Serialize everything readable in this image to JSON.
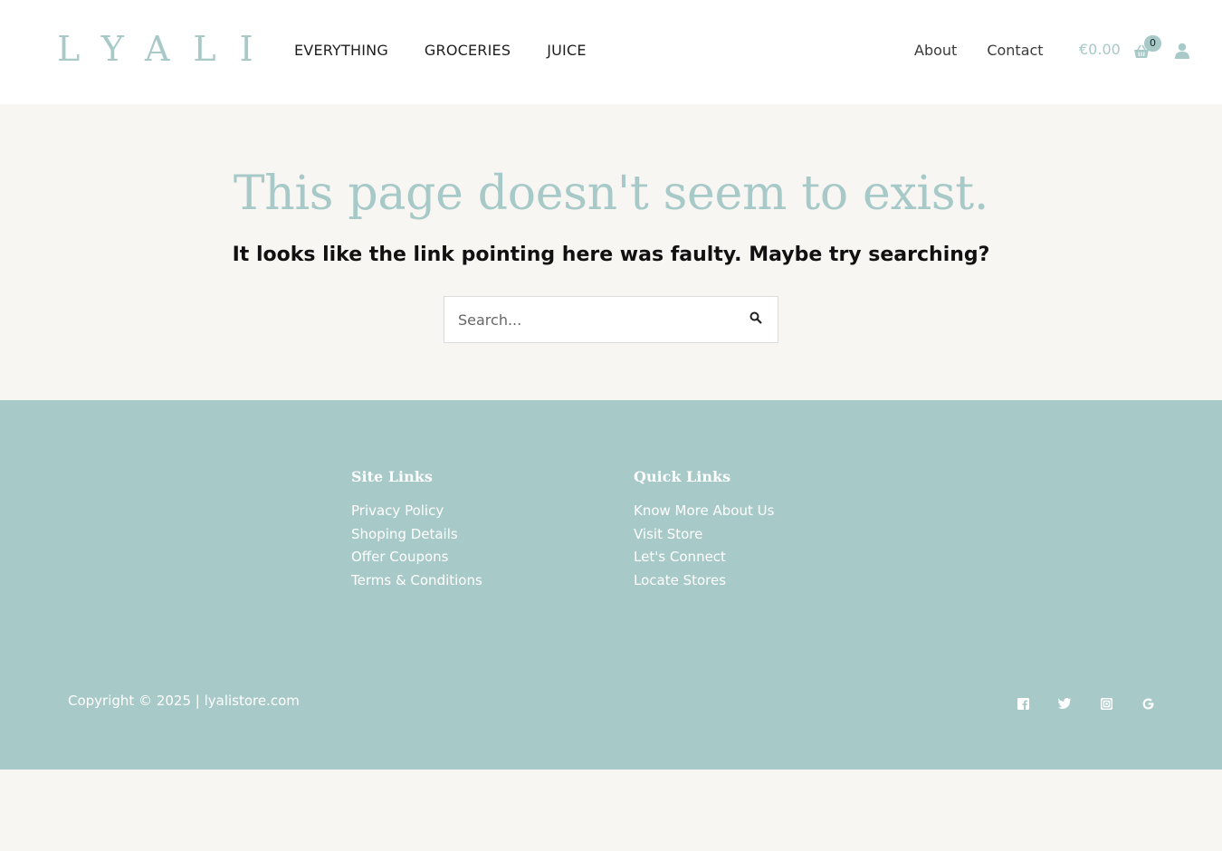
{
  "header": {
    "logo": "LYALI",
    "nav_left": [
      {
        "label": "EVERYTHING"
      },
      {
        "label": "GROCERIES"
      },
      {
        "label": "JUICE"
      }
    ],
    "nav_right": [
      {
        "label": "About"
      },
      {
        "label": "Contact"
      }
    ],
    "cart_total": "€0.00",
    "cart_count": "0",
    "cart_icon": "shopping-basket-icon",
    "user_icon": "user-icon"
  },
  "main": {
    "title": "This page doesn't seem to exist.",
    "subtitle": "It looks like the link pointing here was faulty. Maybe try searching?",
    "search": {
      "placeholder": "Search...",
      "value": "",
      "icon": "search-icon"
    }
  },
  "footer": {
    "site_links": {
      "heading": "Site Links",
      "items": [
        "Privacy Policy",
        "Shoping Details",
        "Offer Coupons",
        "Terms & Conditions"
      ]
    },
    "quick_links": {
      "heading": "Quick Links",
      "items": [
        "Know More About Us",
        "Visit Store",
        "Let's Connect",
        "Locate Stores"
      ]
    },
    "copyright": "Copyright © 2025 | lyalistore.com",
    "socials": [
      "facebook-icon",
      "twitter-icon",
      "instagram-icon",
      "google-icon"
    ]
  },
  "colors": {
    "accent": "#a7c9c7",
    "background": "#f8f6f3",
    "header_bg": "#ffffff",
    "text": "#1e1e1e"
  }
}
